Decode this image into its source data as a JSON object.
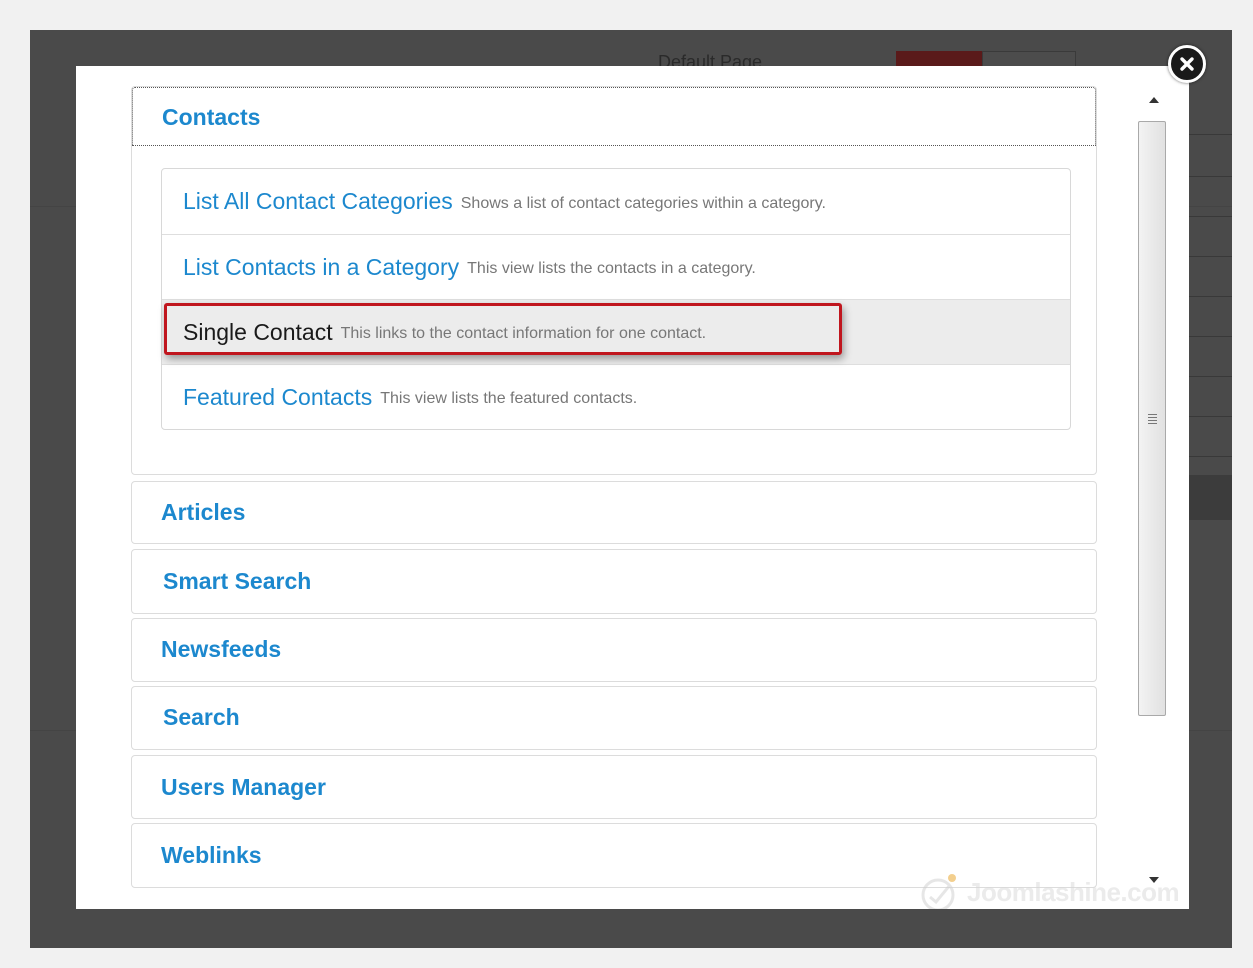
{
  "backdrop": {
    "page_title": "Default Page"
  },
  "modal": {
    "close_icon": "close-circle-icon",
    "groups": [
      {
        "title": "Contacts",
        "expanded": true,
        "items": [
          {
            "title": "List All Contact Categories",
            "description": "Shows a list of contact categories within a category."
          },
          {
            "title": "List Contacts in a Category",
            "description": "This view lists the contacts in a category."
          },
          {
            "title": "Single Contact",
            "description": "This links to the contact information for one contact.",
            "highlighted": true
          },
          {
            "title": "Featured Contacts",
            "description": "This view lists the featured contacts."
          }
        ]
      },
      {
        "title": "Articles",
        "expanded": false
      },
      {
        "title": "Smart Search",
        "expanded": false
      },
      {
        "title": "Newsfeeds",
        "expanded": false
      },
      {
        "title": "Search",
        "expanded": false
      },
      {
        "title": "Users Manager",
        "expanded": false
      },
      {
        "title": "Weblinks",
        "expanded": false
      }
    ]
  },
  "scrollbar": {
    "up_icon": "arrow-up-icon",
    "down_icon": "arrow-down-icon",
    "grip_icon": "grip-icon"
  },
  "watermark": {
    "text": "Joomlashine.com",
    "logo_icon": "joomlashine-logo-icon"
  },
  "colors": {
    "link": "#1c88ce",
    "highlight_border": "#c0161e",
    "active_item_bg": "#ececec",
    "backdrop": "#4a4a4a"
  }
}
